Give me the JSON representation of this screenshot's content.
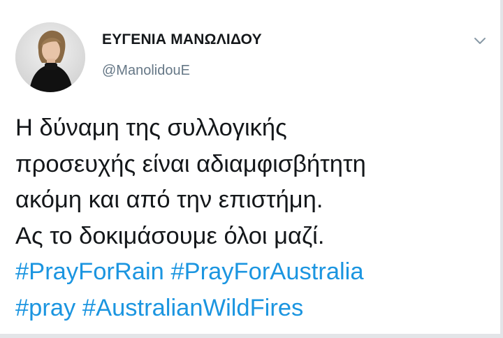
{
  "user": {
    "display_name": "ΕΥΓΕΝΙΑ ΜΑΝΩΛΙΔΟΥ",
    "handle": "@ManolidouE",
    "avatar_icon": "profile-photo"
  },
  "menu": {
    "icon": "chevron-down-icon",
    "color": "#8899a6"
  },
  "tweet": {
    "lines": [
      "Η δύναμη της συλλογικής",
      "προσευχής είναι αδιαμφισβήτητη",
      "ακόμη και από την επιστήμη.",
      "Ας το δοκιμάσουμε όλοι μαζί."
    ],
    "hashtags": [
      "#PrayForRain",
      "#PrayForAustralia",
      "#pray",
      "#AustralianWildFires"
    ],
    "hashtag_color": "#1b95e0",
    "text_color": "#14171a"
  }
}
